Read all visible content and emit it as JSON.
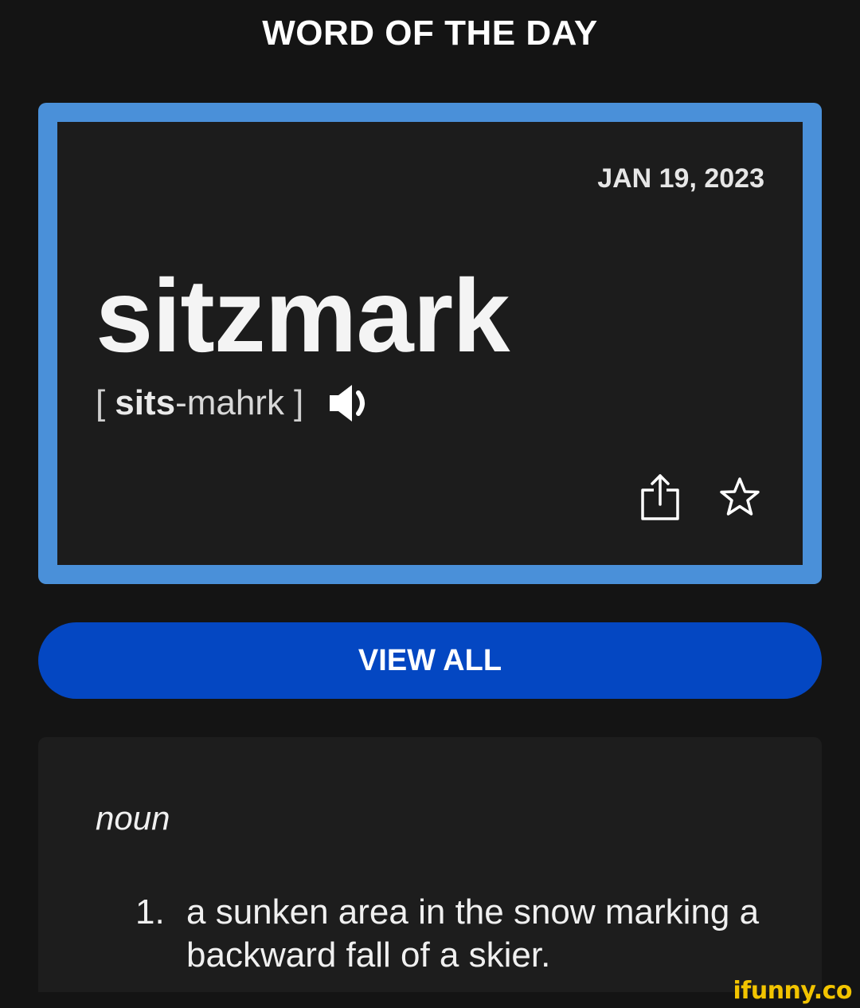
{
  "header": {
    "title": "WORD OF THE DAY"
  },
  "card": {
    "date": "JAN 19, 2023",
    "word": "sitzmark",
    "pronunciation": {
      "open_bracket": "[",
      "stressed": "sits",
      "rest": "-mahrk",
      "close_bracket": "]"
    },
    "icons": {
      "speaker": "speaker-icon",
      "share": "share-icon",
      "favorite": "star-icon"
    },
    "accent_color": "#4a90d9"
  },
  "view_all": {
    "label": "VIEW ALL",
    "color": "#0447c2"
  },
  "definition": {
    "part_of_speech": "noun",
    "items": [
      {
        "number": "1.",
        "text": "a sunken area in the snow marking a backward fall of a skier."
      }
    ]
  },
  "watermark": {
    "text": "ifunny.co",
    "color": "#f2c400"
  }
}
